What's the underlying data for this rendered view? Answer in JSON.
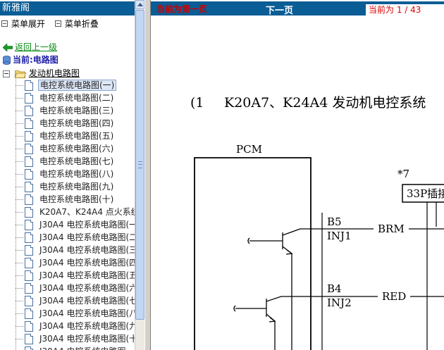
{
  "left_panel": {
    "title": "新雅阁",
    "menu": {
      "expand_label": "菜单展开",
      "collapse_label": "菜单折叠"
    },
    "back_link": "返回上一级",
    "current_label": "当前:电路图",
    "folder": "发动机电路图",
    "items": [
      "电控系统电路图(一)",
      "电控系统电路图(二)",
      "电控系统电路图(三)",
      "电控系统电路图(四)",
      "电控系统电路图(五)",
      "电控系统电路图(六)",
      "电控系统电路图(七)",
      "电控系统电路图(八)",
      "电控系统电路图(九)",
      "电控系统电路图(十)",
      "K20A7、K24A4 点火系统",
      "J30A4 电控系统电路图(一",
      "J30A4 电控系统电路图(二",
      "J30A4 电控系统电路图(三",
      "J30A4 电控系统电路图(四",
      "J30A4 电控系统电路图(五",
      "J30A4 电控系统电路图(六",
      "J30A4 电控系统电路图(七",
      "J30A4 电控系统电路图(八",
      "J30A4 电控系统电路图(九",
      "J30A4 电控系统电路图(十",
      "J30A4 电控系统电路图"
    ],
    "selected_index": 0
  },
  "toolbar": {
    "prev_label": "当前为第一页",
    "next_label": "下一页",
    "page_info": "当前为  1 / 43"
  },
  "diagram": {
    "title_prefix": "(1",
    "title": "K20A7、K24A4 发动机电控系统",
    "pcm_label": "PCM",
    "connector_ref": "*7",
    "connector_label": "33P插接",
    "pins": [
      {
        "pin": "B5",
        "signal": "INJ1",
        "wire": "BRM"
      },
      {
        "pin": "B4",
        "signal": "INJ2",
        "wire": "RED"
      }
    ]
  },
  "colors": {
    "title_bar": "#0b5d95",
    "prev_text": "#cc0000",
    "back_link": "#0a8a16",
    "current_label": "#1c1ca8"
  }
}
